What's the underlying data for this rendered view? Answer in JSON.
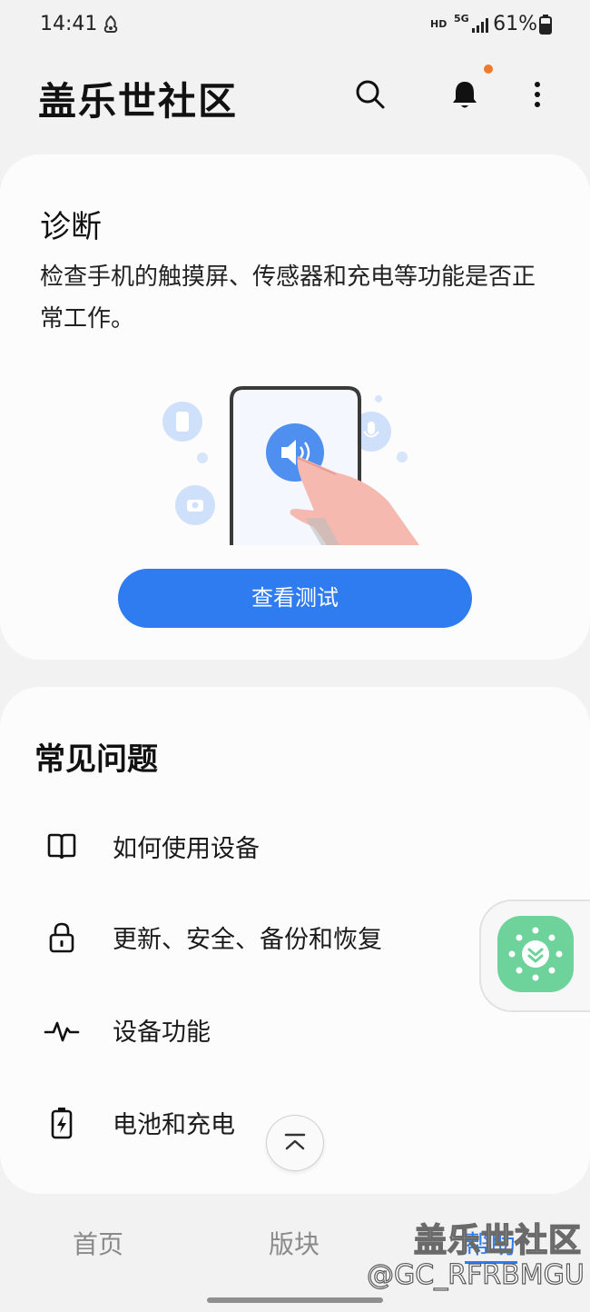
{
  "status_bar": {
    "time": "14:41",
    "network": "HD",
    "network_type": "5G",
    "battery": "61%"
  },
  "app_bar": {
    "title": "盖乐世社区",
    "icons": [
      "search-icon",
      "bell-icon",
      "more-vert-icon"
    ],
    "notification_dot_color": "#f07a2a"
  },
  "diagnostics": {
    "title": "诊断",
    "description": "检查手机的触摸屏、传感器和充电等功能是否正常工作。",
    "button_label": "查看测试",
    "accent_color": "#2f7bf0"
  },
  "faq": {
    "title": "常见问题",
    "items": [
      {
        "label": "如何使用设备",
        "icon": "book-icon"
      },
      {
        "label": "更新、安全、备份和恢复",
        "icon": "lock-icon"
      },
      {
        "label": "设备功能",
        "icon": "pulse-icon"
      },
      {
        "label": "电池和充电",
        "icon": "battery-charging-icon"
      }
    ]
  },
  "bottom_nav": {
    "tabs": [
      "首页",
      "版块",
      "帮助"
    ],
    "active_tab": 2
  },
  "watermark": {
    "title": "盖乐世社区",
    "user": "@GC_RFRBMGU"
  }
}
